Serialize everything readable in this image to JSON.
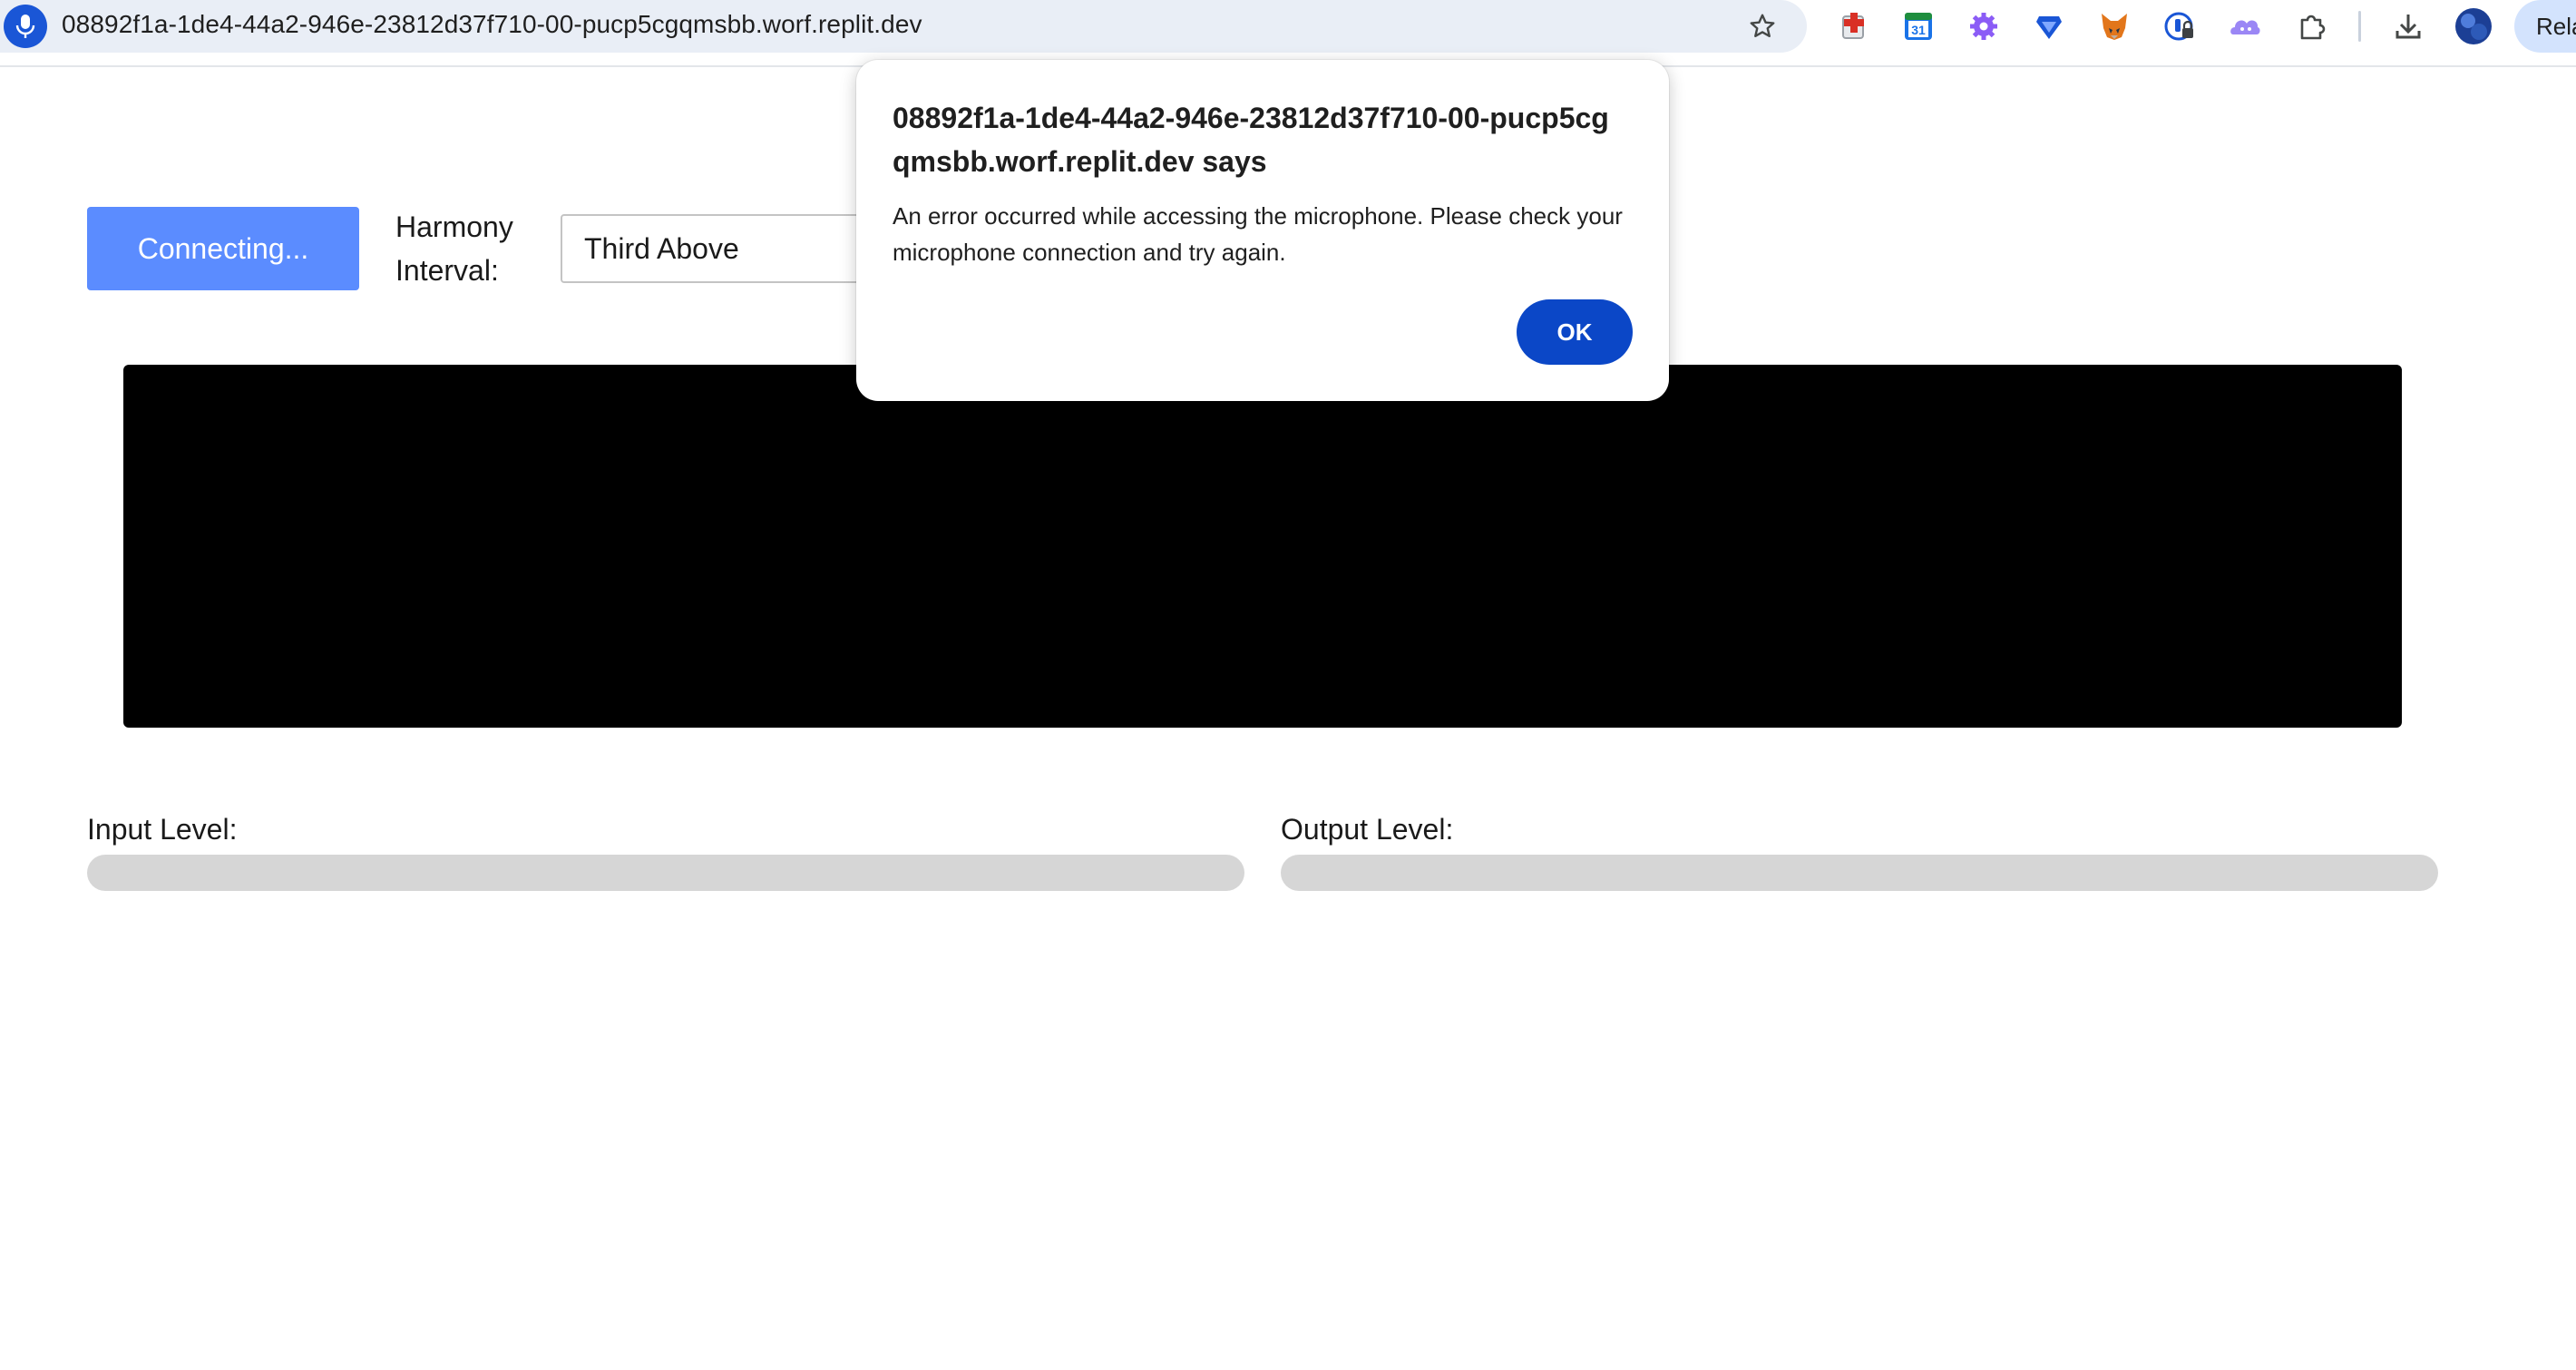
{
  "browser": {
    "url": "08892f1a-1de4-44a2-946e-23812d37f710-00-pucp5cgqmsbb.worf.replit.dev",
    "mic_indicator_icon": "microphone-icon",
    "bookmark_icon": "star-icon",
    "extensions": [
      {
        "name": "red-cross-extension-icon",
        "color": "#d93025"
      },
      {
        "name": "calendar-extension-icon",
        "label": "31",
        "color": "#1e8e3e"
      },
      {
        "name": "gear-extension-icon",
        "color": "#8b5cf6"
      },
      {
        "name": "diamond-extension-icon",
        "color": "#1a56d6"
      },
      {
        "name": "fox-extension-icon",
        "color": "#e2761b"
      },
      {
        "name": "password-lock-extension-icon",
        "color": "#1a56d6"
      },
      {
        "name": "cloud-extension-icon",
        "color": "#9b87f5"
      },
      {
        "name": "puzzle-extensions-icon",
        "color": "#444746"
      }
    ],
    "download_icon": "download-icon",
    "avatar_icon": "avatar-icon",
    "profile_chip_label": "Rela"
  },
  "app": {
    "connect_button_label": "Connecting...",
    "harmony_label": "Harmony Interval:",
    "harmony_selected": "Third Above",
    "input_level_label": "Input Level:",
    "output_level_label": "Output Level:",
    "input_level": 0,
    "output_level": 0,
    "accent_color": "#5b8cff"
  },
  "dialog": {
    "title": "08892f1a-1de4-44a2-946e-23812d37f710-00-pucp5cgqmsbb.worf.replit.dev says",
    "message": "An error occurred while accessing the microphone. Please check your microphone connection and try again.",
    "ok_label": "OK",
    "button_color": "#0b47c7"
  }
}
